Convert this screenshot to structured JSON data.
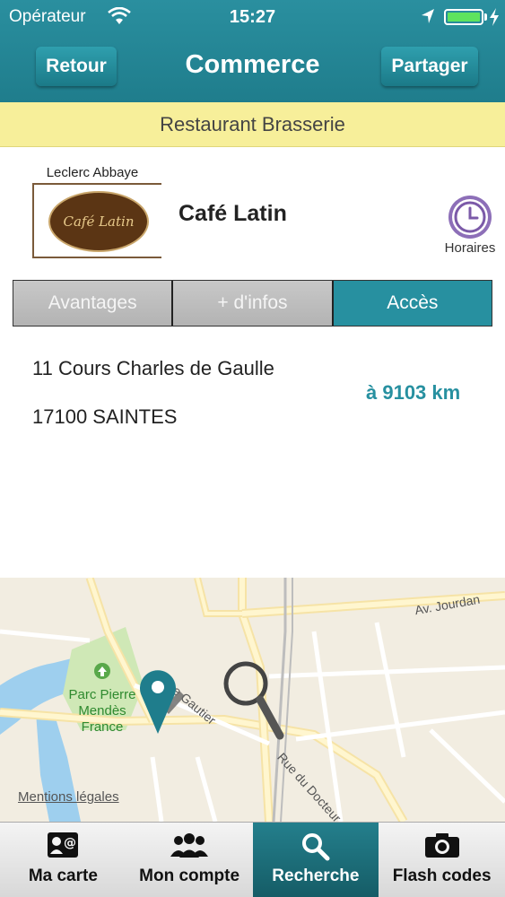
{
  "status_bar": {
    "carrier": "Opérateur",
    "time": "15:27",
    "icons": [
      "wifi-icon",
      "location-arrow-icon",
      "battery-icon",
      "charging-bolt-icon"
    ],
    "battery_color": "#5ee35e"
  },
  "nav": {
    "back_label": "Retour",
    "title": "Commerce",
    "share_label": "Partager",
    "bar_color": "#1f7d8c"
  },
  "category": "Restaurant Brasserie",
  "shop": {
    "logo_header": "Leclerc Abbaye",
    "logo_text": "Café Latin",
    "name": "Café Latin",
    "hours_label": "Horaires"
  },
  "tabs": [
    {
      "label": "Avantages",
      "active": false
    },
    {
      "label": "+ d'infos",
      "active": false
    },
    {
      "label": "Accès",
      "active": true
    }
  ],
  "address": {
    "line1": "11 Cours Charles de Gaulle",
    "line2": "17100 SAINTES",
    "distance": "à 9103 km",
    "accent_color": "#2790a0"
  },
  "map": {
    "park": "Parc Pierre Mendès France",
    "streets": [
      "Av. Jourdan",
      "Rue Gautier",
      "Rue du Docteur"
    ],
    "legal_link": "Mentions légales"
  },
  "tabbar": [
    {
      "label": "Ma carte",
      "icon": "contact-card-icon",
      "active": false
    },
    {
      "label": "Mon compte",
      "icon": "users-icon",
      "active": false
    },
    {
      "label": "Recherche",
      "icon": "search-icon",
      "active": true
    },
    {
      "label": "Flash codes",
      "icon": "camera-icon",
      "active": false
    }
  ]
}
